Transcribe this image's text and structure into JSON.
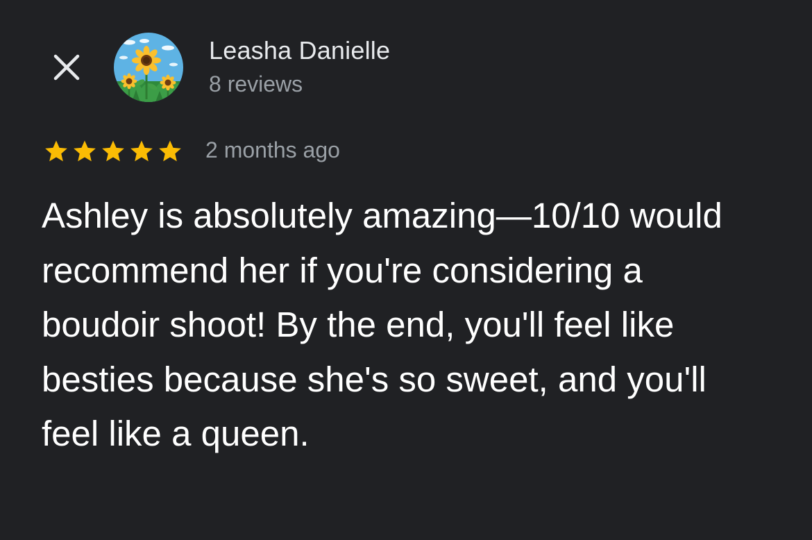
{
  "reviewer": {
    "name": "Leasha Danielle",
    "review_count": "8 reviews",
    "avatar_icon": "sunflower-avatar-icon"
  },
  "review": {
    "rating": 5,
    "max_rating": 5,
    "date": "2 months ago",
    "text": "Ashley is absolutely amazing—10/10 would recommend her if you're considering a boudoir shoot! By the end, you'll feel like besties because she's so sweet, and you'll feel like a queen."
  },
  "controls": {
    "close_icon": "close-icon"
  },
  "colors": {
    "background": "#202124",
    "star": "#fbbc04",
    "primary_text": "#ffffff",
    "secondary_text": "#9aa0a6"
  }
}
